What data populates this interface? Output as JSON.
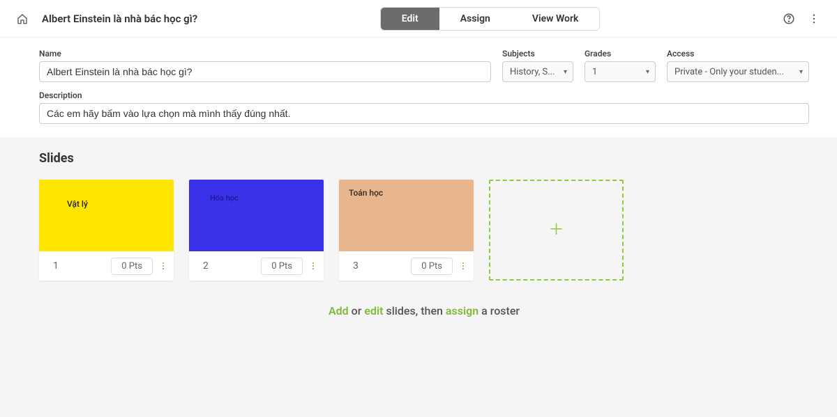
{
  "topbar": {
    "title": "Albert Einstein là nhà bác học gì?",
    "tabs": {
      "edit": "Edit",
      "assign": "Assign",
      "view_work": "View Work"
    }
  },
  "form": {
    "name_label": "Name",
    "name_value": "Albert Einstein là nhà bác học gì?",
    "subjects_label": "Subjects",
    "subjects_value": "History, S...",
    "grades_label": "Grades",
    "grades_value": "1",
    "access_label": "Access",
    "access_value": "Private - Only your studen...",
    "description_label": "Description",
    "description_value": "Các em hãy bấm vào lựa chọn mà mình thấy đúng nhất."
  },
  "slides": {
    "title": "Slides",
    "items": [
      {
        "number": "1",
        "label": "Vật lý",
        "points": "0 Pts",
        "color": "yellow"
      },
      {
        "number": "2",
        "label": "Hóa học",
        "points": "0 Pts",
        "color": "blue"
      },
      {
        "number": "3",
        "label": "Toán học",
        "points": "0 Pts",
        "color": "peach"
      }
    ]
  },
  "hint": {
    "add": "Add",
    "or": " or ",
    "edit": "edit",
    "middle": " slides, then ",
    "assign": "assign",
    "end": " a roster"
  }
}
